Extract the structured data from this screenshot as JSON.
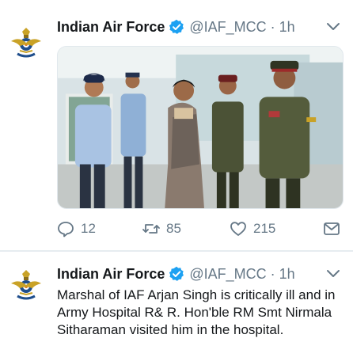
{
  "tweets": [
    {
      "author_name": "Indian Air Force",
      "handle": "@IAF_MCC",
      "separator": "·",
      "time": "1h",
      "stats": {
        "replies": "12",
        "retweets": "85",
        "likes": "215"
      }
    },
    {
      "author_name": "Indian Air Force",
      "handle": "@IAF_MCC",
      "separator": "·",
      "time": "1h",
      "text": "Marshal of IAF Arjan Singh is critically ill and in Army Hospital R& R. Hon'ble RM Smt Nirmala Sitharaman visited him in the hospital."
    }
  ],
  "colors": {
    "verified_blue": "#1da1f2",
    "secondary_text": "#657786",
    "primary_text": "#14171a",
    "separator": "#e6ecf0"
  },
  "icons": [
    "iaf-emblem-avatar",
    "verified-badge-icon",
    "chevron-down-icon",
    "reply-icon",
    "retweet-icon",
    "like-icon",
    "share-icon"
  ]
}
